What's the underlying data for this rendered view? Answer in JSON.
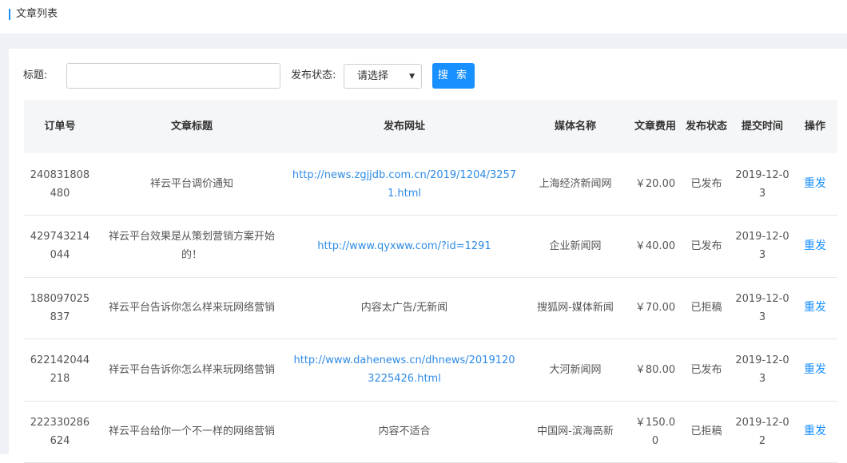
{
  "header": {
    "title": "文章列表"
  },
  "search": {
    "title_label": "标题:",
    "title_value": "",
    "status_label": "发布状态:",
    "status_selected": "请选择",
    "search_button": "搜 索"
  },
  "colors": {
    "accent": "#1890ff",
    "link": "#2f8be6",
    "background_strip": "#eef1f6"
  },
  "table": {
    "columns": [
      "订单号",
      "文章标题",
      "发布网址",
      "媒体名称",
      "文章费用",
      "发布状态",
      "提交时间",
      "操作"
    ],
    "rows": [
      {
        "order_no": "240831808480",
        "title": "祥云平台调价通知",
        "url": "http://news.zgjjdb.com.cn/2019/1204/32571.html",
        "url_is_link": true,
        "media": "上海经济新闻网",
        "fee": "￥20.00",
        "status": "已发布",
        "date": "2019-12-03",
        "action": "重发"
      },
      {
        "order_no": "429743214044",
        "title": "祥云平台效果是从策划营销方案开始的！",
        "url": "http://www.qyxww.com/?id=1291",
        "url_is_link": true,
        "media": "企业新闻网",
        "fee": "￥40.00",
        "status": "已发布",
        "date": "2019-12-03",
        "action": "重发"
      },
      {
        "order_no": "188097025837",
        "title": "祥云平台告诉你怎么样来玩网络营销",
        "url": "内容太广告/无新闻",
        "url_is_link": false,
        "media": "搜狐网-媒体新闻",
        "fee": "￥70.00",
        "status": "已拒稿",
        "date": "2019-12-03",
        "action": "重发"
      },
      {
        "order_no": "622142044218",
        "title": "祥云平台告诉你怎么样来玩网络营销",
        "url": "http://www.dahenews.cn/dhnews/20191203225426.html",
        "url_is_link": true,
        "media": "大河新闻网",
        "fee": "￥80.00",
        "status": "已发布",
        "date": "2019-12-03",
        "action": "重发"
      },
      {
        "order_no": "222330286624",
        "title": "祥云平台给你一个不一样的网络营销",
        "url": "内容不适合",
        "url_is_link": false,
        "media": "中国网-滨海高新",
        "fee": "￥150.00",
        "status": "已拒稿",
        "date": "2019-12-02",
        "action": "重发"
      }
    ]
  }
}
